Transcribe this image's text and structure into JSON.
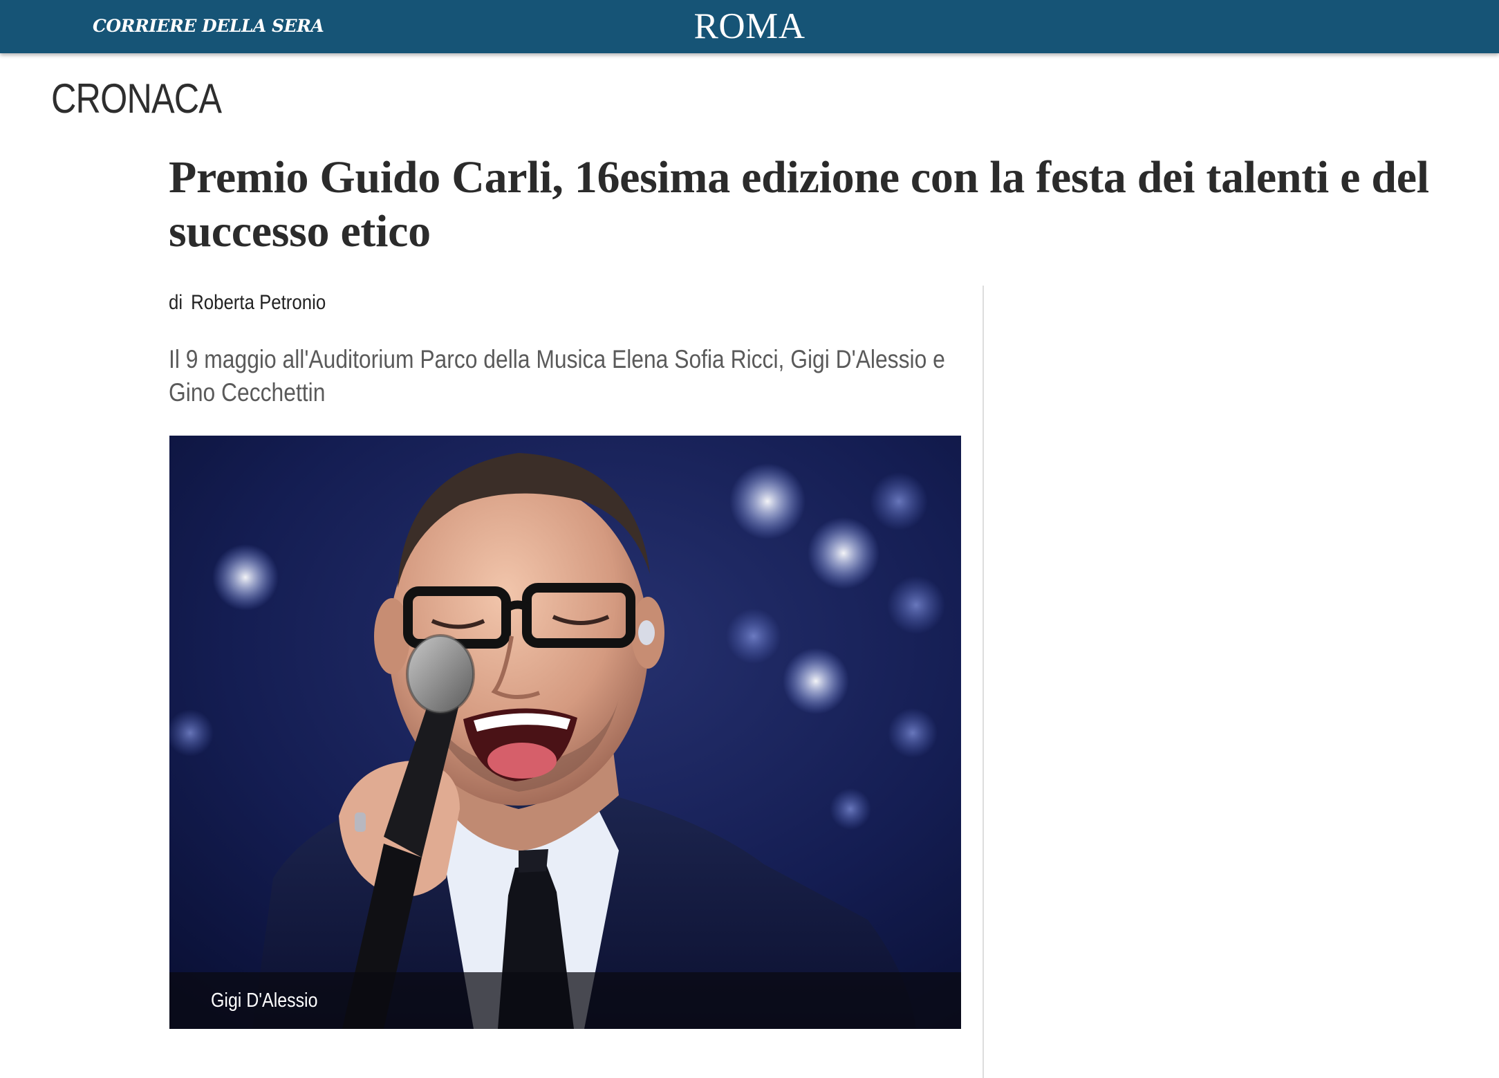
{
  "header": {
    "brand": "CORRIERE DELLA SERA",
    "edition": "ROMA",
    "background_color": "#165476"
  },
  "section": {
    "label": "CRONACA"
  },
  "article": {
    "title": "Premio Guido Carli, 16esima edizione con la festa dei talenti e del successo etico",
    "byline_prefix": "di",
    "author": "Roberta Petronio",
    "summary": "Il 9 maggio all'Auditorium Parco della Musica Elena Sofia Ricci, Gigi D'Alessio e Gino Cecchettin",
    "image": {
      "subject": "singer performing with microphone on stage",
      "caption": "Gigi D'Alessio"
    }
  }
}
